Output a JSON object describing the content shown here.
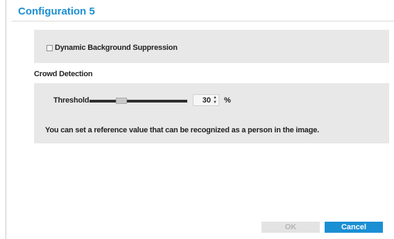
{
  "dialog": {
    "title": "Configuration 5"
  },
  "dynamic_background_suppression": {
    "label": "Dynamic Background Suppression",
    "checked": false
  },
  "crowd_detection": {
    "heading": "Crowd Detection",
    "threshold_label": "Threshold",
    "threshold_value": "30",
    "threshold_fraction": 0.3,
    "unit": "%",
    "description": "You can set a reference value that can be recognized as a person in the image."
  },
  "buttons": {
    "ok_label": "OK",
    "cancel_label": "Cancel"
  },
  "colors": {
    "accent": "#1a8fd4",
    "panel_bg": "#e8e8e8",
    "disabled_bg": "#e3e3e3",
    "disabled_text": "#b5b5b5"
  },
  "icons": {
    "checkbox": "checkbox-unchecked-icon",
    "spin_up": "caret-up-icon",
    "spin_down": "caret-down-icon"
  }
}
